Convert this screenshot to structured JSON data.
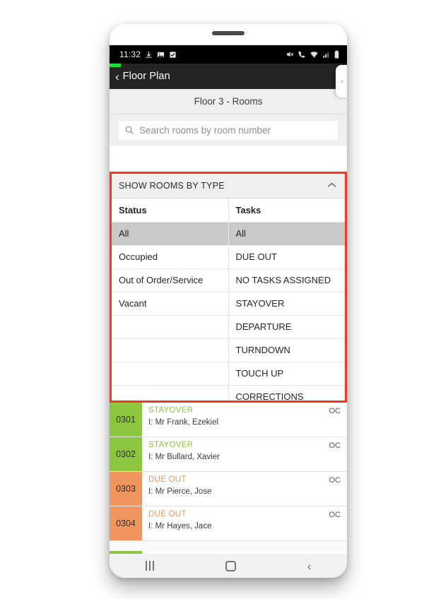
{
  "status_bar": {
    "time": "11:32",
    "left_icons": [
      "download-icon",
      "image-icon",
      "checkbox-icon"
    ],
    "right_icons": [
      "mute-icon",
      "call-icon",
      "wifi-icon",
      "signal-icon",
      "battery-icon"
    ]
  },
  "app_bar": {
    "back_label": "‹",
    "title": "Floor Plan",
    "edge_tab_glyph": "›"
  },
  "sub_header": {
    "title": "Floor 3 - Rooms"
  },
  "search": {
    "placeholder": "Search rooms by room number",
    "value": "",
    "icon": "search-icon"
  },
  "filter_panel": {
    "title": "SHOW ROOMS BY TYPE",
    "collapse_icon": "chevron-up-icon",
    "highlight_color": "#f8361e",
    "columns": [
      "Status",
      "Tasks"
    ],
    "rows": [
      {
        "status": "All",
        "task": "All",
        "selected": true
      },
      {
        "status": "Occupied",
        "task": "DUE OUT",
        "selected": false
      },
      {
        "status": "Out of Order/Service",
        "task": "NO TASKS ASSIGNED",
        "selected": false
      },
      {
        "status": "Vacant",
        "task": "STAYOVER",
        "selected": false
      },
      {
        "status": "",
        "task": "DEPARTURE",
        "selected": false
      },
      {
        "status": "",
        "task": "TURNDOWN",
        "selected": false
      },
      {
        "status": "",
        "task": "TOUCH UP",
        "selected": false
      },
      {
        "status": "",
        "task": "CORRECTIONS",
        "selected": false
      }
    ]
  },
  "room_list": {
    "status_colors": {
      "stayover": "#8cc63e",
      "due_out": "#f0955e"
    },
    "rooms": [
      {
        "number": "0301",
        "task": "STAYOVER",
        "task_color": "#8cc63e",
        "tile_color": "#8cc63e",
        "guest": "I: Mr Frank, Ezekiel",
        "code": "OC"
      },
      {
        "number": "0302",
        "task": "STAYOVER",
        "task_color": "#8cc63e",
        "tile_color": "#8cc63e",
        "guest": "I: Mr Bullard, Xavier",
        "code": "OC"
      },
      {
        "number": "0303",
        "task": "DUE OUT",
        "task_color": "#f0955e",
        "tile_color": "#f0955e",
        "guest": "I: Mr Pierce, Jose",
        "code": "OC"
      },
      {
        "number": "0304",
        "task": "DUE OUT",
        "task_color": "#f0955e",
        "tile_color": "#f0955e",
        "guest": "I: Mr Hayes, Jace",
        "code": "OC"
      }
    ]
  },
  "nav_bar_primary": {
    "recent_label": "recent-apps-icon",
    "home_label": "home-icon",
    "back_label": "back-icon"
  },
  "nav_bar_secondary": {
    "back_label": "back-arrow-icon",
    "home_label": "home-outline-icon",
    "menu_label": "menu-icon"
  }
}
